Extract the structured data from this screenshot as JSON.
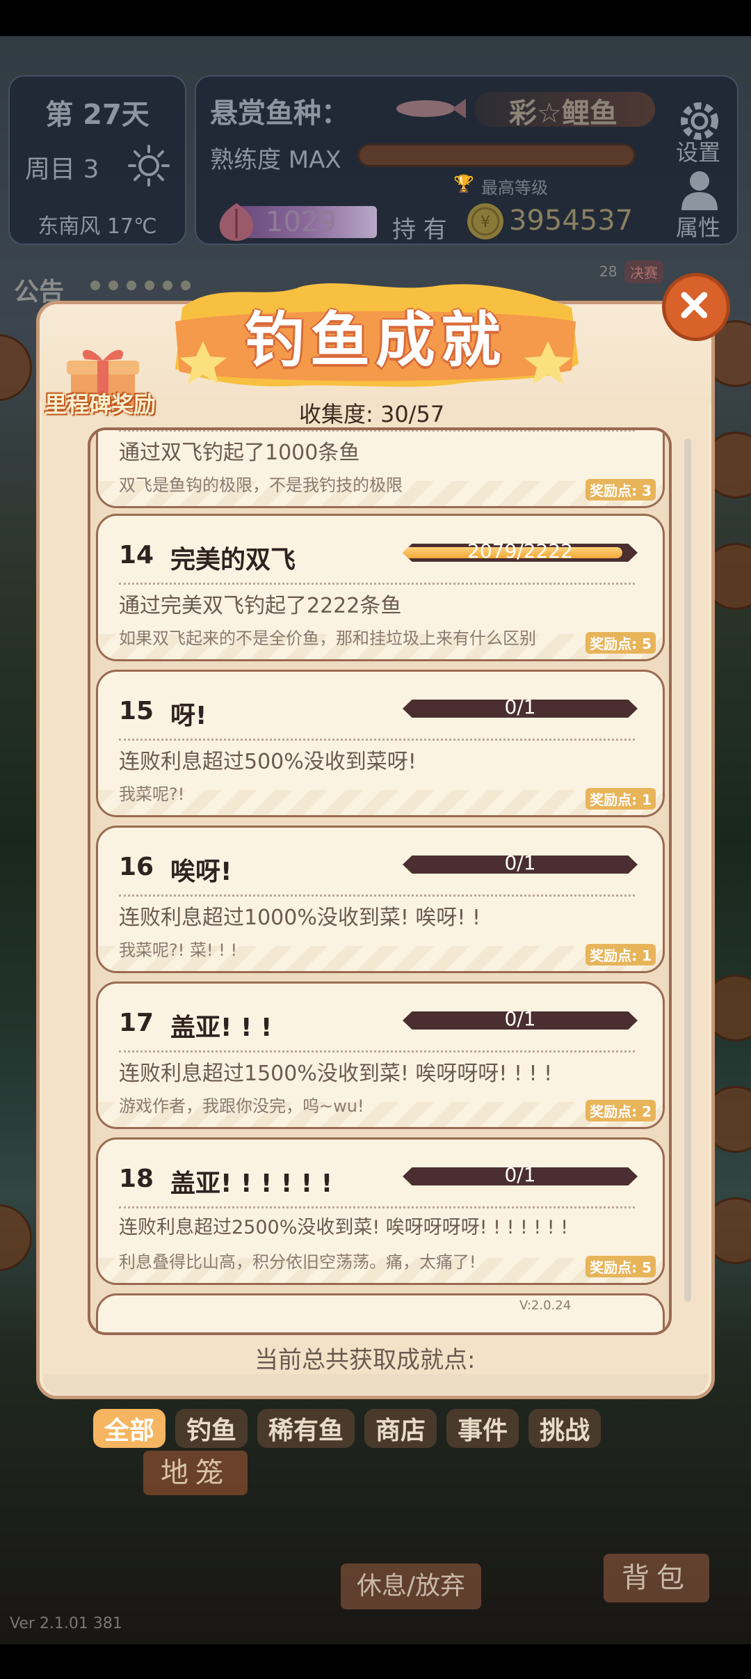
{
  "hud": {
    "day": "第 27天",
    "round": "周目 3",
    "weather": "东南风 17℃",
    "bounty_label": "悬赏鱼种：",
    "bounty_fish": "彩☆鲤鱼",
    "proficiency_label": "熟练度 MAX",
    "proficiency_progress": 1.0,
    "top_level": "最高等级",
    "gems": "1029",
    "hold_label": "持 有",
    "money": "3954537",
    "settings_label": "设置",
    "attributes_label": "属性"
  },
  "notice": {
    "label": "公告",
    "final_count": "28",
    "final_badge": "决赛"
  },
  "modal": {
    "title": "钓鱼成就",
    "milestone_label": "里程碑奖励",
    "collection": "收集度:  30/57",
    "total_label": "当前总共获取成就点:",
    "version": "V:2.0.24"
  },
  "achievements": [
    {
      "num": "",
      "title": "",
      "desc": "通过双飞钓起了1000条鱼",
      "flavor": "双飞是鱼钩的极限，不是我钓技的极限",
      "reward": "奖励点: 3",
      "progress_text": "",
      "progress": 0
    },
    {
      "num": "14",
      "title": "完美的双飞",
      "desc": "通过完美双飞钓起了2222条鱼",
      "flavor": "如果双飞起来的不是全价鱼，那和挂垃圾上来有什么区别",
      "reward": "奖励点: 5",
      "progress_text": "2079/2222",
      "progress": 0.936
    },
    {
      "num": "15",
      "title": "呀!",
      "desc": "连败利息超过500%没收到菜呀!",
      "flavor": "我菜呢?!",
      "reward": "奖励点: 1",
      "progress_text": "0/1",
      "progress": 0
    },
    {
      "num": "16",
      "title": "唉呀!",
      "desc": "连败利息超过1000%没收到菜! 唉呀! !",
      "flavor": "我菜呢?! 菜! ! !",
      "reward": "奖励点: 1",
      "progress_text": "0/1",
      "progress": 0
    },
    {
      "num": "17",
      "title": "盖亚! ! !",
      "desc": "连败利息超过1500%没收到菜! 唉呀呀呀! ! ! !",
      "flavor": "游戏作者，我跟你没完，呜~wu!",
      "reward": "奖励点: 2",
      "progress_text": "0/1",
      "progress": 0
    },
    {
      "num": "18",
      "title": "盖亚! ! ! ! ! !",
      "desc": "连败利息超过2500%没收到菜! 唉呀呀呀呀! ! ! ! ! ! !",
      "flavor": "利息叠得比山高，积分依旧空荡荡。痛，太痛了!",
      "reward": "奖励点: 5",
      "progress_text": "0/1",
      "progress": 0
    }
  ],
  "tabs": [
    "全部",
    "钓鱼",
    "稀有鱼",
    "商店",
    "事件",
    "挑战"
  ],
  "buttons": {
    "cage": "地笼",
    "rest": "休息/放弃",
    "bag": "背包"
  },
  "footer_version": "Ver 2.1.01 381",
  "colors": {
    "accent": "#f5b561",
    "close": "#d8622a",
    "card_bg": "#fbf3e1",
    "progress_fill": "#f3a83a",
    "progress_track": "#4a2e30"
  }
}
